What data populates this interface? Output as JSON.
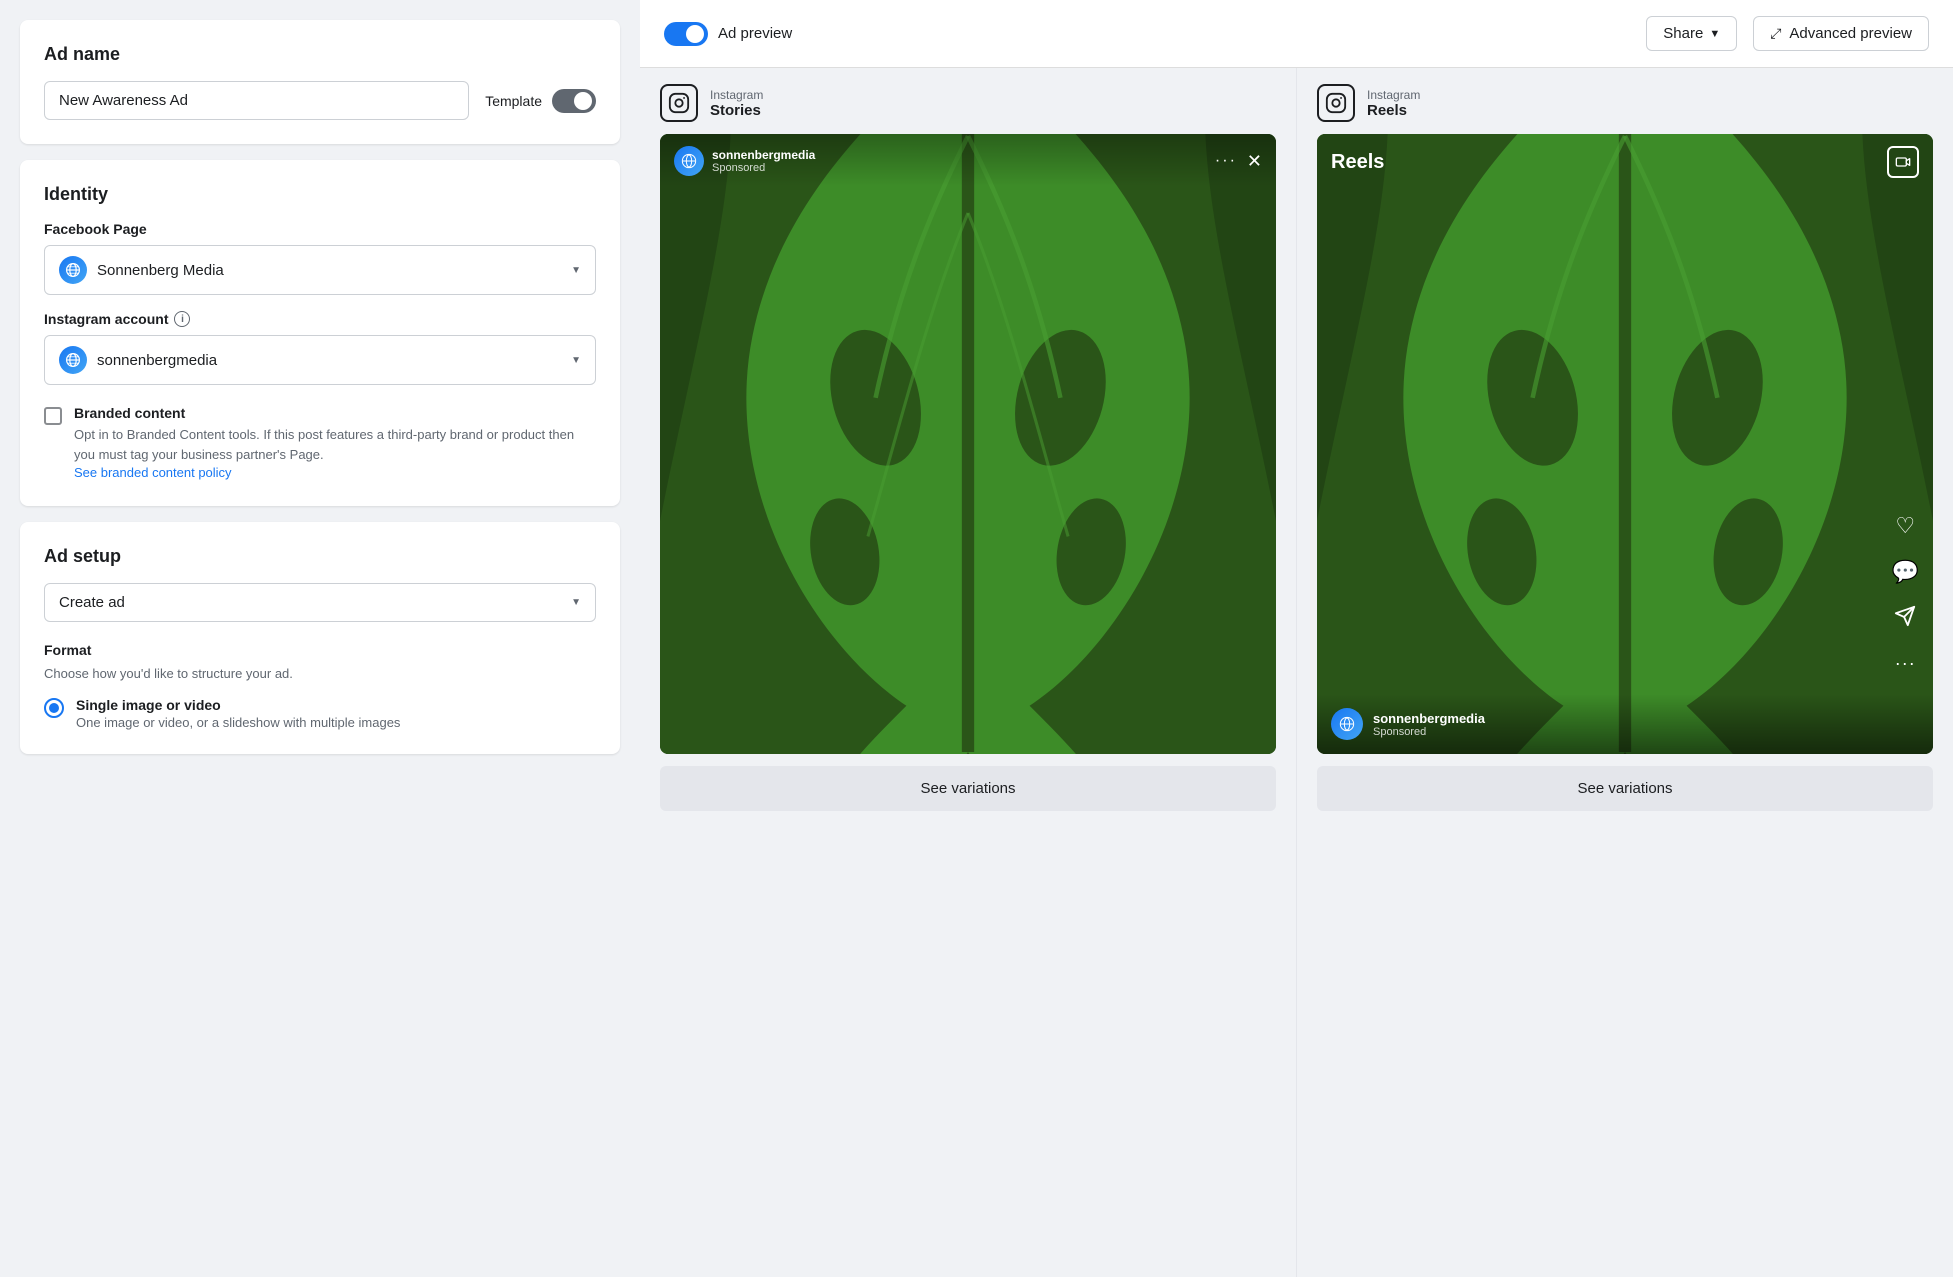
{
  "left": {
    "ad_name_section": {
      "title": "Ad name",
      "input_value": "New Awareness Ad",
      "template_label": "Template"
    },
    "identity_section": {
      "title": "Identity",
      "facebook_page_label": "Facebook Page",
      "facebook_page_value": "Sonnenberg Media",
      "instagram_account_label": "Instagram account",
      "instagram_account_value": "sonnenbergmedia",
      "branded_content": {
        "label": "Branded content",
        "description": "Opt in to Branded Content tools. If this post features a third-party brand or product then you must tag your business partner's Page.",
        "link_text": "See branded content policy"
      }
    },
    "ad_setup_section": {
      "title": "Ad setup",
      "setup_value": "Create ad",
      "format_label": "Format",
      "format_desc": "Choose how you'd like to structure your ad.",
      "format_option_label": "Single image or video",
      "format_option_desc": "One image or video, or a slideshow with multiple images"
    }
  },
  "right": {
    "header": {
      "ad_preview_label": "Ad preview",
      "share_label": "Share",
      "advanced_preview_label": "Advanced preview"
    },
    "preview_columns": [
      {
        "platform": "Instagram",
        "type": "Stories",
        "username": "sonnenbergmedia",
        "sponsored": "Sponsored",
        "see_variations": "See variations"
      },
      {
        "platform": "Instagram",
        "type": "Reels",
        "username": "sonnenbergmedia",
        "sponsored": "Sponsored",
        "see_variations": "See variations"
      }
    ]
  }
}
